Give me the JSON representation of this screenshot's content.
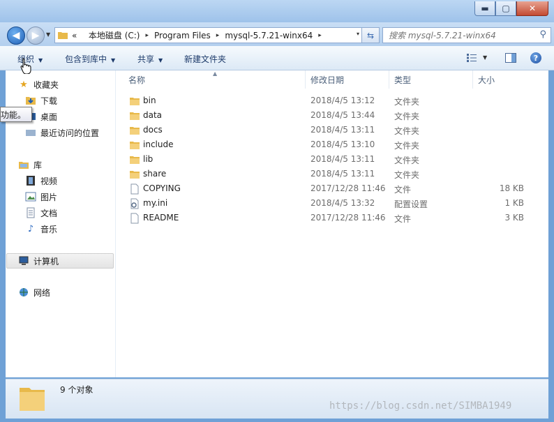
{
  "window": {
    "controls": {
      "minimize": "▬",
      "maximize": "▢",
      "close": "✕"
    }
  },
  "address": {
    "overflow": "«",
    "crumbs": [
      "本地磁盘 (C:)",
      "Program Files",
      "mysql-5.7.21-winx64"
    ],
    "separator": "▸",
    "dropdown": "▾"
  },
  "search": {
    "placeholder": "搜索 mysql-5.7.21-winx64"
  },
  "toolbar": {
    "organize": "组织",
    "include_in_library": "包含到库中",
    "share": "共享",
    "new_folder": "新建文件夹",
    "help": "?"
  },
  "tooltip": {
    "text": "功能。"
  },
  "nav": {
    "favorites": {
      "label": "收藏夹",
      "items": [
        "下载",
        "桌面",
        "最近访问的位置"
      ]
    },
    "libraries": {
      "label": "库",
      "items": [
        "视频",
        "图片",
        "文档",
        "音乐"
      ]
    },
    "computer": {
      "label": "计算机"
    },
    "network": {
      "label": "网络"
    }
  },
  "columns": {
    "name": "名称",
    "modified": "修改日期",
    "type": "类型",
    "size": "大小"
  },
  "files": [
    {
      "name": "bin",
      "modified": "2018/4/5 13:12",
      "type": "文件夹",
      "size": "",
      "kind": "folder"
    },
    {
      "name": "data",
      "modified": "2018/4/5 13:44",
      "type": "文件夹",
      "size": "",
      "kind": "folder"
    },
    {
      "name": "docs",
      "modified": "2018/4/5 13:11",
      "type": "文件夹",
      "size": "",
      "kind": "folder"
    },
    {
      "name": "include",
      "modified": "2018/4/5 13:10",
      "type": "文件夹",
      "size": "",
      "kind": "folder"
    },
    {
      "name": "lib",
      "modified": "2018/4/5 13:11",
      "type": "文件夹",
      "size": "",
      "kind": "folder"
    },
    {
      "name": "share",
      "modified": "2018/4/5 13:11",
      "type": "文件夹",
      "size": "",
      "kind": "folder"
    },
    {
      "name": "COPYING",
      "modified": "2017/12/28 11:46",
      "type": "文件",
      "size": "18 KB",
      "kind": "file"
    },
    {
      "name": "my.ini",
      "modified": "2018/4/5 13:32",
      "type": "配置设置",
      "size": "1 KB",
      "kind": "config"
    },
    {
      "name": "README",
      "modified": "2017/12/28 11:46",
      "type": "文件",
      "size": "3 KB",
      "kind": "file"
    }
  ],
  "status": {
    "count": "9 个对象"
  },
  "watermark": "https://blog.csdn.net/SIMBA1949",
  "colors": {
    "folder": "#e8b94a",
    "accent": "#1f5fb5"
  }
}
